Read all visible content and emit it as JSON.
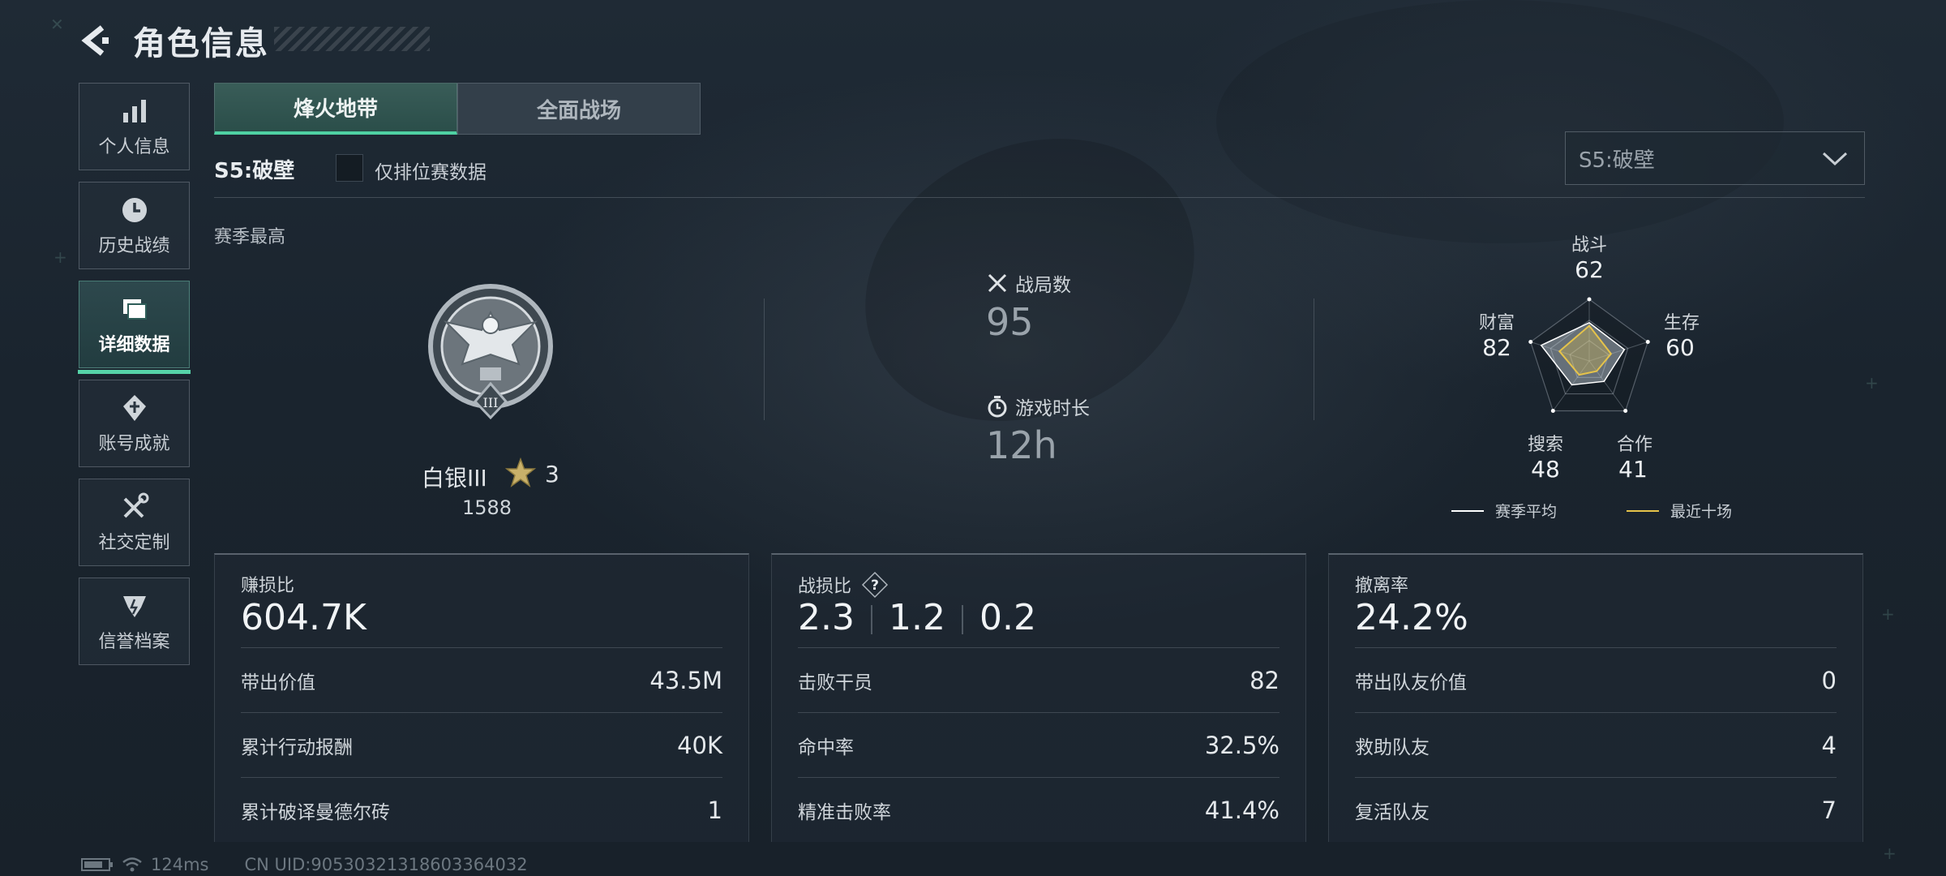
{
  "header": {
    "title": "角色信息"
  },
  "sidebar": {
    "items": [
      {
        "label": "个人信息",
        "icon": "bar-chart-icon"
      },
      {
        "label": "历史战绩",
        "icon": "clock-icon"
      },
      {
        "label": "详细数据",
        "icon": "documents-icon",
        "active": true
      },
      {
        "label": "账号成就",
        "icon": "achievement-icon"
      },
      {
        "label": "社交定制",
        "icon": "tools-icon"
      },
      {
        "label": "信誉档案",
        "icon": "shield-icon"
      }
    ]
  },
  "tabs": [
    {
      "label": "烽火地带",
      "active": true
    },
    {
      "label": "全面战场",
      "active": false
    }
  ],
  "filter": {
    "season": "S5:破壁",
    "ranked_only_label": "仅排位赛数据",
    "ranked_only_checked": false,
    "season_select": "S5:破壁"
  },
  "season_best": {
    "label": "赛季最高",
    "rank_name": "白银III",
    "stars": "3",
    "score": "1588",
    "badge_numeral": "III"
  },
  "summary": {
    "matches_label": "战局数",
    "matches_value": "95",
    "playtime_label": "游戏时长",
    "playtime_value": "12h"
  },
  "radar": {
    "axes": [
      {
        "label": "战斗",
        "value": "62"
      },
      {
        "label": "生存",
        "value": "60"
      },
      {
        "label": "合作",
        "value": "41"
      },
      {
        "label": "搜索",
        "value": "48"
      },
      {
        "label": "财富",
        "value": "82"
      }
    ],
    "legend_avg": "赛季平均",
    "legend_recent": "最近十场",
    "avg_color": "#ffffff",
    "recent_color": "#e5c34a"
  },
  "cards": [
    {
      "title": "赚损比",
      "big": "604.7K",
      "rows": [
        {
          "label": "带出价值",
          "value": "43.5M"
        },
        {
          "label": "累计行动报酬",
          "value": "40K"
        },
        {
          "label": "累计破译曼德尔砖",
          "value": "1"
        }
      ]
    },
    {
      "title": "战损比",
      "big_parts": [
        "2.3",
        "1.2",
        "0.2"
      ],
      "rows": [
        {
          "label": "击败干员",
          "value": "82"
        },
        {
          "label": "命中率",
          "value": "32.5%"
        },
        {
          "label": "精准击败率",
          "value": "41.4%"
        }
      ]
    },
    {
      "title": "撤离率",
      "big": "24.2%",
      "rows": [
        {
          "label": "带出队友价值",
          "value": "0"
        },
        {
          "label": "救助队友",
          "value": "4"
        },
        {
          "label": "复活队友",
          "value": "7"
        }
      ]
    }
  ],
  "footer": {
    "ping": "124ms",
    "uid": "CN UID:9053032131860336403​2"
  }
}
